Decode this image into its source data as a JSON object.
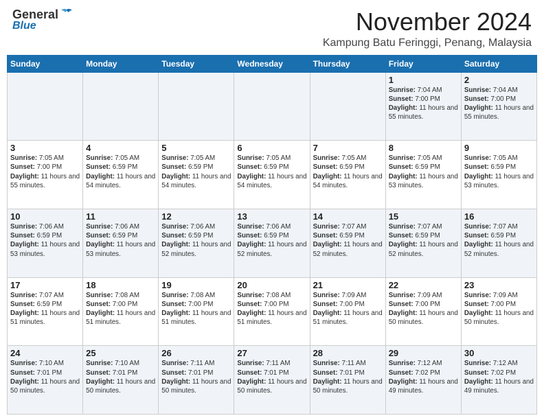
{
  "header": {
    "logo_general": "General",
    "logo_blue": "Blue",
    "month_title": "November 2024",
    "location": "Kampung Batu Feringgi, Penang, Malaysia"
  },
  "weekdays": [
    "Sunday",
    "Monday",
    "Tuesday",
    "Wednesday",
    "Thursday",
    "Friday",
    "Saturday"
  ],
  "weeks": [
    [
      {
        "day": "",
        "info": ""
      },
      {
        "day": "",
        "info": ""
      },
      {
        "day": "",
        "info": ""
      },
      {
        "day": "",
        "info": ""
      },
      {
        "day": "",
        "info": ""
      },
      {
        "day": "1",
        "info": "Sunrise: 7:04 AM\nSunset: 7:00 PM\nDaylight: 11 hours and 55 minutes."
      },
      {
        "day": "2",
        "info": "Sunrise: 7:04 AM\nSunset: 7:00 PM\nDaylight: 11 hours and 55 minutes."
      }
    ],
    [
      {
        "day": "3",
        "info": "Sunrise: 7:05 AM\nSunset: 7:00 PM\nDaylight: 11 hours and 55 minutes."
      },
      {
        "day": "4",
        "info": "Sunrise: 7:05 AM\nSunset: 6:59 PM\nDaylight: 11 hours and 54 minutes."
      },
      {
        "day": "5",
        "info": "Sunrise: 7:05 AM\nSunset: 6:59 PM\nDaylight: 11 hours and 54 minutes."
      },
      {
        "day": "6",
        "info": "Sunrise: 7:05 AM\nSunset: 6:59 PM\nDaylight: 11 hours and 54 minutes."
      },
      {
        "day": "7",
        "info": "Sunrise: 7:05 AM\nSunset: 6:59 PM\nDaylight: 11 hours and 54 minutes."
      },
      {
        "day": "8",
        "info": "Sunrise: 7:05 AM\nSunset: 6:59 PM\nDaylight: 11 hours and 53 minutes."
      },
      {
        "day": "9",
        "info": "Sunrise: 7:05 AM\nSunset: 6:59 PM\nDaylight: 11 hours and 53 minutes."
      }
    ],
    [
      {
        "day": "10",
        "info": "Sunrise: 7:06 AM\nSunset: 6:59 PM\nDaylight: 11 hours and 53 minutes."
      },
      {
        "day": "11",
        "info": "Sunrise: 7:06 AM\nSunset: 6:59 PM\nDaylight: 11 hours and 53 minutes."
      },
      {
        "day": "12",
        "info": "Sunrise: 7:06 AM\nSunset: 6:59 PM\nDaylight: 11 hours and 52 minutes."
      },
      {
        "day": "13",
        "info": "Sunrise: 7:06 AM\nSunset: 6:59 PM\nDaylight: 11 hours and 52 minutes."
      },
      {
        "day": "14",
        "info": "Sunrise: 7:07 AM\nSunset: 6:59 PM\nDaylight: 11 hours and 52 minutes."
      },
      {
        "day": "15",
        "info": "Sunrise: 7:07 AM\nSunset: 6:59 PM\nDaylight: 11 hours and 52 minutes."
      },
      {
        "day": "16",
        "info": "Sunrise: 7:07 AM\nSunset: 6:59 PM\nDaylight: 11 hours and 52 minutes."
      }
    ],
    [
      {
        "day": "17",
        "info": "Sunrise: 7:07 AM\nSunset: 6:59 PM\nDaylight: 11 hours and 51 minutes."
      },
      {
        "day": "18",
        "info": "Sunrise: 7:08 AM\nSunset: 7:00 PM\nDaylight: 11 hours and 51 minutes."
      },
      {
        "day": "19",
        "info": "Sunrise: 7:08 AM\nSunset: 7:00 PM\nDaylight: 11 hours and 51 minutes."
      },
      {
        "day": "20",
        "info": "Sunrise: 7:08 AM\nSunset: 7:00 PM\nDaylight: 11 hours and 51 minutes."
      },
      {
        "day": "21",
        "info": "Sunrise: 7:09 AM\nSunset: 7:00 PM\nDaylight: 11 hours and 51 minutes."
      },
      {
        "day": "22",
        "info": "Sunrise: 7:09 AM\nSunset: 7:00 PM\nDaylight: 11 hours and 50 minutes."
      },
      {
        "day": "23",
        "info": "Sunrise: 7:09 AM\nSunset: 7:00 PM\nDaylight: 11 hours and 50 minutes."
      }
    ],
    [
      {
        "day": "24",
        "info": "Sunrise: 7:10 AM\nSunset: 7:01 PM\nDaylight: 11 hours and 50 minutes."
      },
      {
        "day": "25",
        "info": "Sunrise: 7:10 AM\nSunset: 7:01 PM\nDaylight: 11 hours and 50 minutes."
      },
      {
        "day": "26",
        "info": "Sunrise: 7:11 AM\nSunset: 7:01 PM\nDaylight: 11 hours and 50 minutes."
      },
      {
        "day": "27",
        "info": "Sunrise: 7:11 AM\nSunset: 7:01 PM\nDaylight: 11 hours and 50 minutes."
      },
      {
        "day": "28",
        "info": "Sunrise: 7:11 AM\nSunset: 7:01 PM\nDaylight: 11 hours and 50 minutes."
      },
      {
        "day": "29",
        "info": "Sunrise: 7:12 AM\nSunset: 7:02 PM\nDaylight: 11 hours and 49 minutes."
      },
      {
        "day": "30",
        "info": "Sunrise: 7:12 AM\nSunset: 7:02 PM\nDaylight: 11 hours and 49 minutes."
      }
    ]
  ]
}
